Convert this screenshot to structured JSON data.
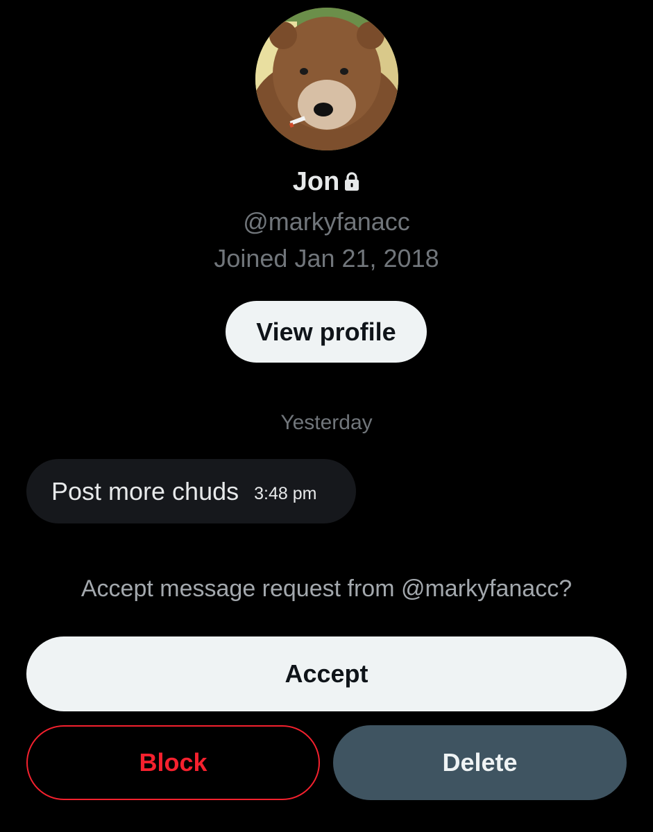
{
  "profile": {
    "avatar_icon": "bear-avatar",
    "display_name": "Jon",
    "protected_icon": "lock-icon",
    "handle": "@markyfanacc",
    "joined": "Joined Jan 21, 2018",
    "view_profile_label": "View profile"
  },
  "conversation": {
    "date_separator": "Yesterday",
    "messages": [
      {
        "text": "Post more chuds",
        "time": "3:48 pm"
      }
    ]
  },
  "request": {
    "prompt": "Accept message request from @markyfanacc?",
    "accept_label": "Accept",
    "block_label": "Block",
    "delete_label": "Delete"
  },
  "colors": {
    "background": "#000000",
    "primary_text": "#e7e9ea",
    "secondary_text": "#71767b",
    "block_red": "#f4212e",
    "delete_bg": "#3f5461",
    "light_button_bg": "#eff3f4"
  }
}
